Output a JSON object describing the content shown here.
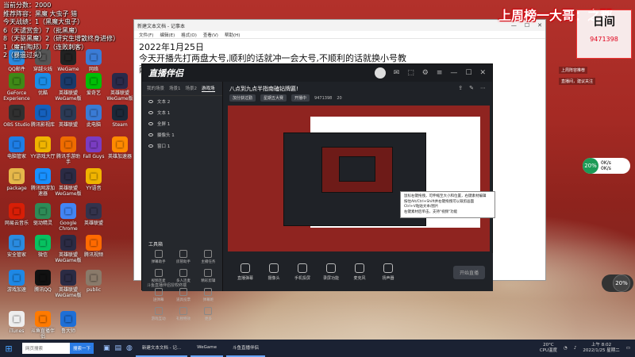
{
  "overlay_stats": {
    "lines": [
      "当前分数：2000",
      "推荐阵容：黑魔 大虫子 猎",
      "今天战绩：1（黑魔大虫子）",
      "6（天谴赏金）7（批黑魔）",
      "8（天驱黑魔）2（研究生增散终身进修）",
      "1（魔前陶邦）7（连败刺客）",
      "2（暴遥过头）"
    ]
  },
  "desktop_icons": [
    {
      "label": "QQ邮件",
      "icon": "mail-icon",
      "color": "#2a8be0"
    },
    {
      "label": "穿越火线",
      "icon": "game-icon",
      "color": "#555"
    },
    {
      "label": "WeGame",
      "icon": "wegame-icon",
      "color": "#222"
    },
    {
      "label": "网络",
      "icon": "network-icon",
      "color": "#3b7cd6"
    },
    {
      "label": "GeForce Experience",
      "icon": "geforce-icon",
      "color": "#3f8a17"
    },
    {
      "label": "优酷",
      "icon": "youku-icon",
      "color": "#1a8ce6"
    },
    {
      "label": "英雄联盟WeGame版",
      "icon": "lol-icon",
      "color": "#1a3a6a"
    },
    {
      "label": "爱奇艺",
      "icon": "iqiyi-icon",
      "color": "#00be06"
    },
    {
      "label": "英雄联盟WeGame版",
      "icon": "lol-icon",
      "color": "#2a2a4a"
    },
    {
      "label": "OBS Studio",
      "icon": "obs-icon",
      "color": "#303030"
    },
    {
      "label": "腾讯影视库",
      "icon": "video-icon",
      "color": "#1560bd"
    },
    {
      "label": "英雄联盟",
      "icon": "lol-icon",
      "color": "#2b3a55"
    },
    {
      "label": "此电脑",
      "icon": "computer-icon",
      "color": "#3a7bd5"
    },
    {
      "label": "Steam",
      "icon": "steam-icon",
      "color": "#1b2838"
    },
    {
      "label": "电脑管家",
      "icon": "shield-icon",
      "color": "#1e7ee6"
    },
    {
      "label": "YY游戏大厅",
      "icon": "yy-icon",
      "color": "#f0b400"
    },
    {
      "label": "腾讯手游助手",
      "icon": "gamepad-icon",
      "color": "#ef6c00"
    },
    {
      "label": "Fall Guys",
      "icon": "fallguys-icon",
      "color": "#7a3cc2"
    },
    {
      "label": "英雄加速器",
      "icon": "rocket-icon",
      "color": "#ff8a00"
    },
    {
      "label": "package",
      "icon": "folder-icon",
      "color": "#e6b84a"
    },
    {
      "label": "腾讯网游加速器",
      "icon": "accelerator-icon",
      "color": "#1890ff"
    },
    {
      "label": "英雄联盟WeGame版",
      "icon": "lol-icon",
      "color": "#2b2b44"
    },
    {
      "label": "YY语音",
      "icon": "yy-icon",
      "color": "#f0b400"
    },
    {
      "label": "网易云音乐",
      "icon": "music-icon",
      "color": "#d81e06"
    },
    {
      "label": "驱动精灵",
      "icon": "driver-icon",
      "color": "#2e8b57"
    },
    {
      "label": "Google Chrome",
      "icon": "chrome-icon",
      "color": "#4285f4"
    },
    {
      "label": "英雄联盟",
      "icon": "lol-icon",
      "color": "#33334c"
    },
    {
      "label": "安全管家",
      "icon": "security-icon",
      "color": "#2a8be0"
    },
    {
      "label": "微信",
      "icon": "wechat-icon",
      "color": "#07c160"
    },
    {
      "label": "英雄联盟WeGame版",
      "icon": "lol-icon",
      "color": "#2b2b44"
    },
    {
      "label": "腾讯视频",
      "icon": "tencentvideo-icon",
      "color": "#ff6a00"
    },
    {
      "label": "游戏加速",
      "icon": "speed-icon",
      "color": "#1e88e5"
    },
    {
      "label": "腾讯QQ",
      "icon": "qq-icon",
      "color": "#111"
    },
    {
      "label": "英雄联盟WeGame版",
      "icon": "lol-icon",
      "color": "#2b2b44"
    },
    {
      "label": "public",
      "icon": "folder-icon",
      "color": "#8a7a6a"
    },
    {
      "label": "iTunes",
      "icon": "itunes-icon",
      "color": "#eee"
    },
    {
      "label": "斗鱼直播伴侣",
      "icon": "douyu-icon",
      "color": "#ff7a00"
    },
    {
      "label": "鲁大师",
      "icon": "ludashi-icon",
      "color": "#1e6fd6"
    }
  ],
  "notepad": {
    "title": "新建文本文档 - 记事本",
    "menu": [
      "文件(F)",
      "编辑(E)",
      "格式(O)",
      "查看(V)",
      "帮助(H)"
    ],
    "lines": [
      "2022年1月25日",
      "今天开播先打两盘大号,顺利的话就冲一会大号,不顺利的话就换小号教",
      "两套赛季去好上分的阵容!大家在赛季末都能上到自己想到的段位"
    ]
  },
  "stream_app": {
    "logo": "直播伴侣",
    "tabs": [
      "我的场景",
      "场景1",
      "场景2",
      "游戏场"
    ],
    "sources": [
      "文本 2",
      "文本 1",
      "全屏 1",
      "摄像头 1",
      "窗口 1"
    ],
    "tools_title": "工具箱",
    "tools": [
      "弹幕助手",
      "房管助手",
      "主播任务",
      "视频连麦",
      "多人连麦",
      "精彩剪辑",
      "送弹幕",
      "道具投票",
      "弹幕姬",
      "游戏互动",
      "礼物特效",
      "更多"
    ],
    "room_title": "八点到九点半指南磕钻牌匾!",
    "room_pills": [
      "加分获过勤",
      "星期五大赛",
      "开播中"
    ],
    "room_count": "9471398",
    "room_fans": "20",
    "bottom_buttons": [
      "直播弹幕",
      "摄像头",
      "手机投屏",
      "录屏功能",
      "麦克风",
      "扬声器"
    ],
    "start_button": "开始直播",
    "status": "斗鱼直播伴侣授权终端"
  },
  "tooltip": {
    "lines": [
      "鼠标右键拖拽，可伸缩至大小和位置，右键素材编辑",
      "按住Alt/Ctrl+Shift并右键拖拽可以裁剪画面",
      "Ctrl+V粘贴文本/图片",
      "右键素材后单击，支持\"视频\"功能"
    ]
  },
  "right_overlay": {
    "rank_text": "上周榜一大哥：之郡",
    "anchor_logo": "日间",
    "anchor_number": "9471398",
    "panel_label": "上周阵容推荐",
    "panel_link": "直播间，建议关注"
  },
  "widgets": {
    "cpu_percent": "20%",
    "net_up": "0K/s",
    "net_down": "0K/s",
    "mem_percent": "20%"
  },
  "taskbar": {
    "search_placeholder": "网页搜索",
    "search_button": "搜索一下",
    "tasks": [
      "新建文本文档 - 记...",
      "WeGame",
      "斗鱼直播伴侣"
    ],
    "temp": "20°C",
    "weather": "CPU温度",
    "time": "上午 8:02",
    "date": "2022/1/25 星期二"
  }
}
